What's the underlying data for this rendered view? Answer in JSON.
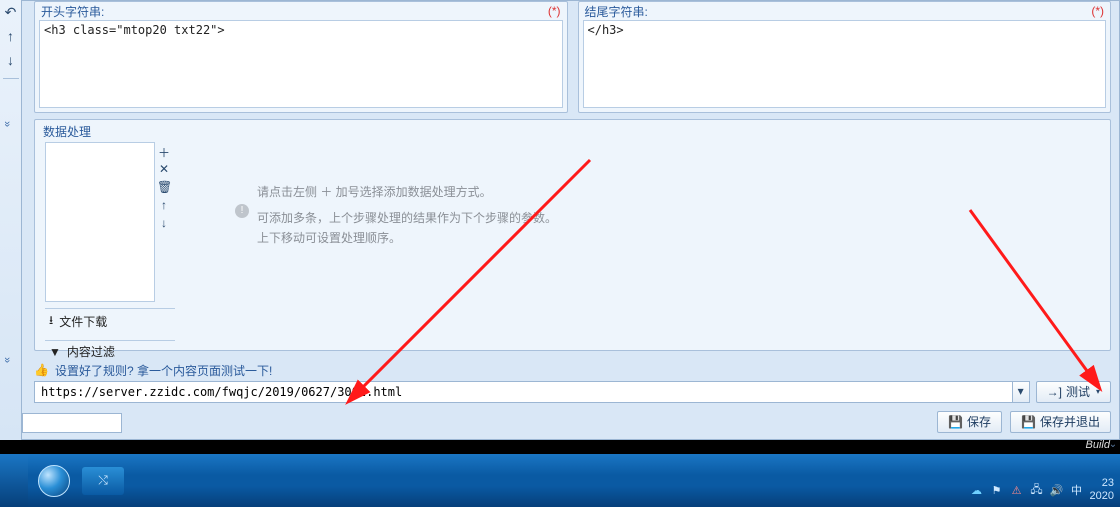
{
  "row1": {
    "left_label": "开头字符串:",
    "right_label": "结尾字符串:",
    "required_marker": "(*)",
    "left_value": "<h3 class=\"mtop20 txt22\">",
    "right_value": "</h3>"
  },
  "dataproc": {
    "title": "数据处理",
    "hint_line1": "请点击左侧 ＋ 加号选择添加数据处理方式。",
    "hint_line2": "可添加多条，上个步骤处理的结果作为下个步骤的参数。上下移动可设置处理顺序。",
    "link_download": "文件下载",
    "link_filter": "内容过滤"
  },
  "urlbar": {
    "prompt": "设置好了规则? 拿一个内容页面测试一下!",
    "value": "https://server.zzidc.com/fwqjc/2019/0627/3002.html",
    "test_label": "测试"
  },
  "buttons": {
    "save": "保存",
    "save_exit": "保存并退出"
  },
  "taskbar": {
    "build": "Build",
    "time": "23",
    "date": "2020"
  },
  "icons": {
    "undo": "↶",
    "down": "↓",
    "up": "↑",
    "chevron": "»",
    "plus": "＋",
    "close": "✕",
    "trash": "🗑",
    "download": "⭳",
    "filter": "▼",
    "thumb": "👍",
    "login": "→]",
    "disk": "💾",
    "dd": "▾"
  }
}
